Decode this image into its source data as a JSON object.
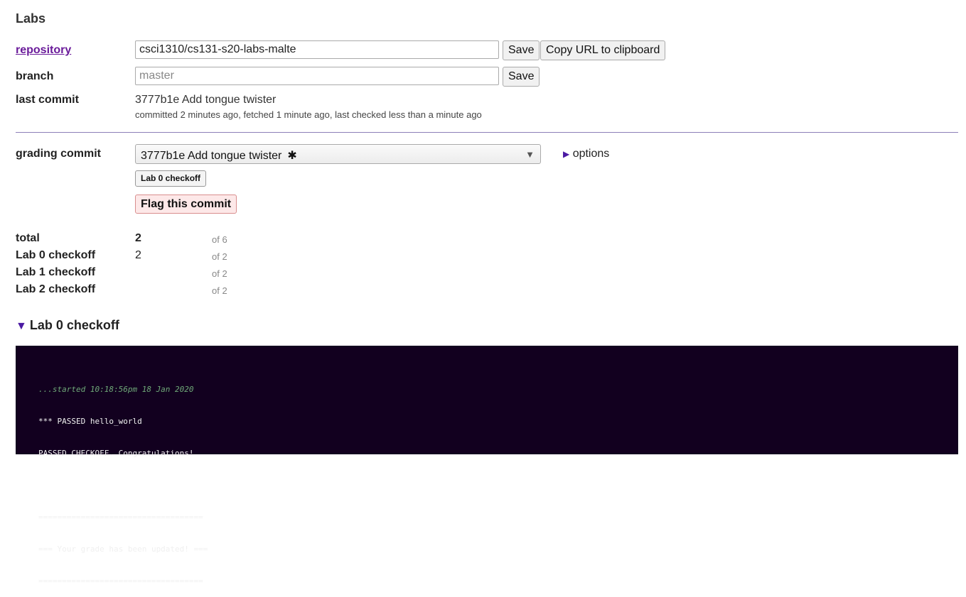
{
  "page": {
    "title": "Labs"
  },
  "repository": {
    "label": "repository",
    "value": "csci1310/cs131-s20-labs-malte",
    "save_label": "Save",
    "copy_label": "Copy URL to clipboard"
  },
  "branch": {
    "label": "branch",
    "placeholder": "master",
    "save_label": "Save"
  },
  "last_commit": {
    "label": "last commit",
    "summary": "3777b1e Add tongue twister",
    "meta": "committed 2 minutes ago, fetched 1 minute ago, last checked less than a minute ago"
  },
  "grading": {
    "label": "grading commit",
    "selected": "3777b1e Add tongue twister",
    "marker": "✱",
    "options_label": "options",
    "checkoff_button": "Lab 0 checkoff",
    "flag_button": "Flag this commit"
  },
  "scores": [
    {
      "label": "total",
      "value": "2",
      "max": "of 6"
    },
    {
      "label": "Lab 0 checkoff",
      "value": "2",
      "max": "of 2"
    },
    {
      "label": "Lab 1 checkoff",
      "value": "",
      "max": "of 2"
    },
    {
      "label": "Lab 2 checkoff",
      "value": "",
      "max": "of 2"
    }
  ],
  "section": {
    "title": "Lab 0 checkoff",
    "log": {
      "started": "...started 10:18:56pm 18 Jan 2020",
      "lines": [
        "*** PASSED hello_world",
        "PASSED CHECKOFF. Congratulations!",
        "",
        "===================================",
        "=== Your grade has been updated! ===",
        "==================================="
      ]
    }
  },
  "colors": {
    "link": "#6a1b9a",
    "accent": "#4b1aa3",
    "terminal_bg": "#12001f",
    "flag_bg": "#fde8e8"
  },
  "icons": {
    "options_toggle": "triangle-right-icon",
    "section_toggle": "triangle-down-icon",
    "select_caret": "caret-down-icon"
  }
}
